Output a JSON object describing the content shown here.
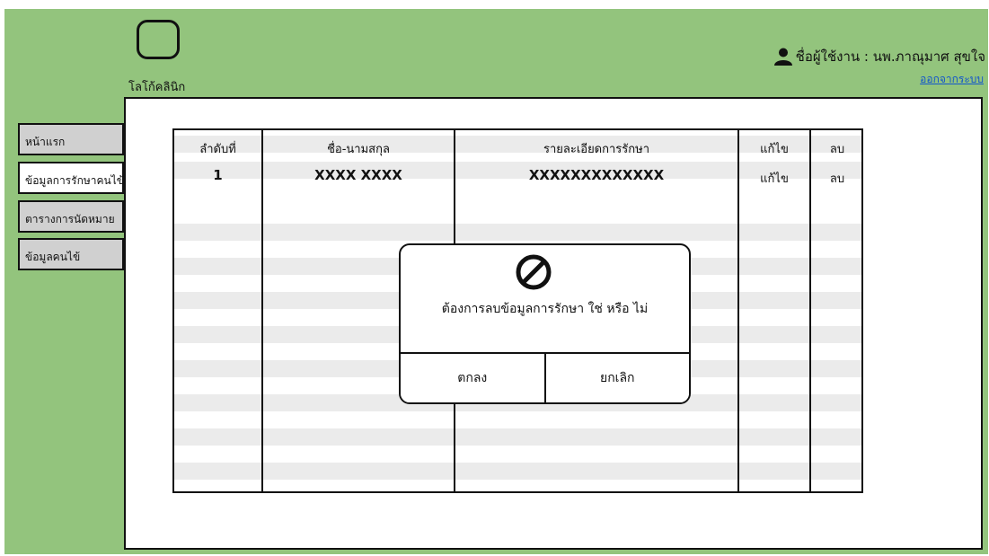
{
  "app": {
    "logo_text": "โลโก้คลินิก",
    "user_label": "ชื่อผู้ใช้งาน : นพ.ภาณุมาศ  สุขใจ",
    "logout": "ออกจากระบบ"
  },
  "sidebar": {
    "items": [
      {
        "label": "หน้าแรก"
      },
      {
        "label": "ข้อมูลการรักษาคนไข้"
      },
      {
        "label": "ตารางการนัดหมาย"
      },
      {
        "label": "ข้อมูลคนไข้"
      }
    ]
  },
  "table": {
    "headers": [
      "ลำดับที่",
      "ชื่อ-นามสกุล",
      "รายละเอียดการรักษา",
      "แก้ไข",
      "ลบ"
    ],
    "rows": [
      {
        "index": "1",
        "name": "XXXX XXXX",
        "detail": "XXXXXXXXXXXXX",
        "edit": "แก้ไข",
        "delete": "ลบ"
      }
    ]
  },
  "dialog": {
    "message": "ต้องการลบข้อมูลการรักษา ใช่ หรือ ไม่",
    "ok": "ตกลง",
    "cancel": "ยกเลิก",
    "icon": "prohibited-icon"
  }
}
